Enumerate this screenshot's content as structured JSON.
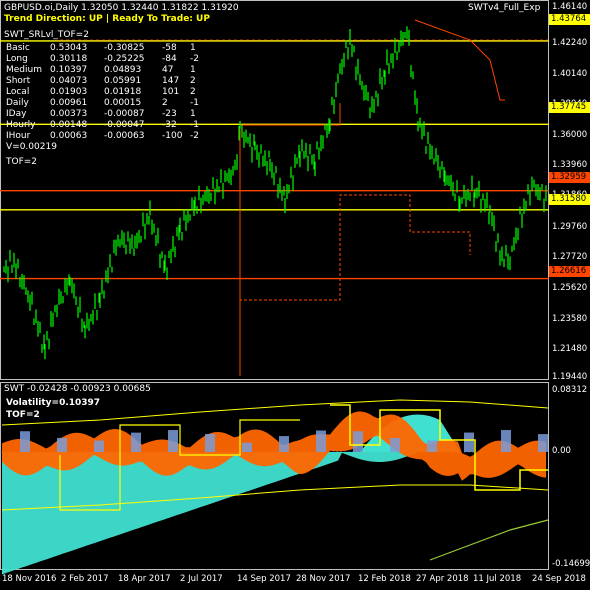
{
  "header": {
    "symbol_line": "GBPUSD.oi,Daily  1.32050 1.32440 1.31822 1.31920",
    "indicator_name": "SWTv4_Full_Exp",
    "trend_line": "Trend Direction:  UP  |  Ready To Trade:  UP",
    "srlvl_label": "SWT_SRLvl_TOF=2"
  },
  "stats": {
    "rows": [
      {
        "name": "Basic",
        "v1": "0.53043",
        "v2": "-0.30825",
        "v3": "-58",
        "v4": "1"
      },
      {
        "name": "Long",
        "v1": "0.30118",
        "v2": "-0.25225",
        "v3": "-84",
        "v4": "-2"
      },
      {
        "name": "Medium",
        "v1": "0.10397",
        "v2": "0.04893",
        "v3": "47",
        "v4": "1"
      },
      {
        "name": "Short",
        "v1": "0.04073",
        "v2": "0.05991",
        "v3": "147",
        "v4": "2"
      },
      {
        "name": "Local",
        "v1": "0.01903",
        "v2": "0.01918",
        "v3": "101",
        "v4": "2"
      },
      {
        "name": "Daily",
        "v1": "0.00961",
        "v2": "0.00015",
        "v3": "2",
        "v4": "-1"
      },
      {
        "name": "IDay",
        "v1": "0.00373",
        "v2": "-0.00087",
        "v3": "-23",
        "v4": "1"
      },
      {
        "name": "Hourly",
        "v1": "0.00148",
        "v2": "-0.00047",
        "v3": "-32",
        "v4": "-1"
      },
      {
        "name": "IHour",
        "v1": "0.00063",
        "v2": "-0.00063",
        "v3": "-100",
        "v4": "-2"
      }
    ],
    "v_line": "V=0.00219",
    "tof_line": "TOF=2"
  },
  "price_axis": {
    "ticks": [
      "1.46140",
      "1.42240",
      "1.40140",
      "1.38040",
      "1.36000",
      "1.33960",
      "1.31860",
      "1.29760",
      "1.27720",
      "1.25620",
      "1.23580",
      "1.21480",
      "1.19440"
    ],
    "levels": [
      {
        "value": "1.43764",
        "color": "#ffff00"
      },
      {
        "value": "1.37745",
        "color": "#ffff00"
      },
      {
        "value": "1.32959",
        "color": "#ff4500"
      },
      {
        "value": "1.31580",
        "color": "#ffff00"
      },
      {
        "value": "1.26616",
        "color": "#ff4500"
      }
    ]
  },
  "sub_window": {
    "title": "SWT -0.02428 -0.00923 0.00685",
    "volatility": "Volatility=0.10397",
    "tof": "TOF=2",
    "ticks": [
      "0.08312",
      "0.00",
      "-0.14699"
    ]
  },
  "time_axis": {
    "labels": [
      "18 Nov 2016",
      "2 Feb 2017",
      "18 Apr 2017",
      "2 Jul 2017",
      "14 Sep 2017",
      "28 Nov 2017",
      "12 Feb 2018",
      "27 Apr 2018",
      "11 Jul 2018",
      "24 Sep 2018"
    ]
  },
  "colors": {
    "price": "#00ff00",
    "support_resistance": "#ffff00",
    "stop_line": "#ff4500",
    "histogram_orange": "#ff6600",
    "histogram_cyan": "#40e0d0",
    "histogram_blue": "#7b9bd8",
    "grid_frame": "#c0c0c0"
  }
}
